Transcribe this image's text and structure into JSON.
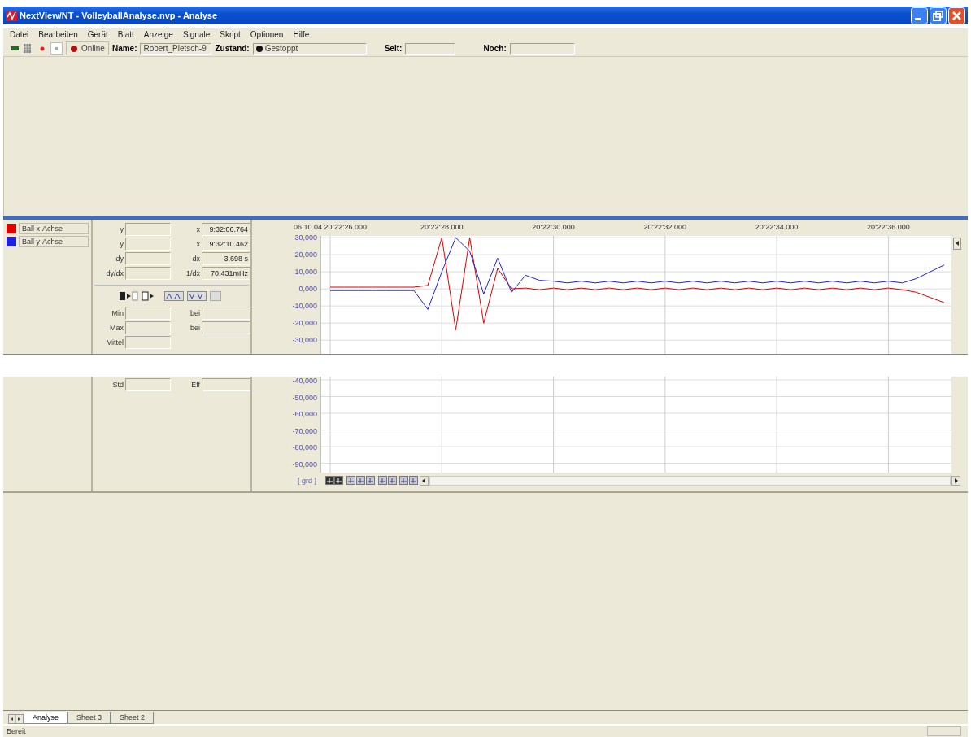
{
  "window": {
    "title": "NextView/NT - VolleyballAnalyse.nvp - Analyse"
  },
  "menu": [
    "Datei",
    "Bearbeiten",
    "Gerät",
    "Blatt",
    "Anzeige",
    "Signale",
    "Skript",
    "Optionen",
    "Hilfe"
  ],
  "toolbar": {
    "mode": "Online",
    "name_label": "Name:",
    "name_value": "Robert_Pietsch-9",
    "state_label": "Zustand:",
    "state_value": "Gestoppt",
    "since_label": "Seit:",
    "remaining_label": "Noch:"
  },
  "cursor": [
    {
      "label": "y",
      "label2": "x",
      "value2": "9:32:06.764"
    },
    {
      "label": "y",
      "label2": "x",
      "value2": "9:32:10.462"
    },
    {
      "label": "dy",
      "label2": "dx",
      "value2": "3,698 s"
    },
    {
      "label": "dy/dx",
      "label2": "1/dx",
      "value2": "70,431mHz"
    }
  ],
  "stats": [
    {
      "label": "Min",
      "label2": "bei"
    },
    {
      "label": "Max",
      "label2": "bei"
    },
    {
      "label": "Mittel"
    }
  ],
  "stats_lower": [
    {
      "label": "Std",
      "label2": "Eff"
    }
  ],
  "chart": {
    "chart_data": {
      "type": "line",
      "categories": [
        "06.10.04 20:22:26.000",
        null,
        null,
        null,
        null,
        null,
        null,
        null,
        "20:22:28.000",
        null,
        null,
        null,
        null,
        null,
        null,
        null,
        "20:22:30.000",
        null,
        null,
        null,
        null,
        null,
        null,
        null,
        "20:22:32.000",
        null,
        null,
        null,
        null,
        null,
        null,
        null,
        "20:22:34.000",
        null,
        null,
        null,
        null,
        null,
        null,
        null,
        "20:22:36.000",
        null,
        null,
        null,
        null
      ],
      "series": [
        {
          "name": "Ball x-Achse",
          "color": "#e00000",
          "values": [
            1000,
            1000,
            1000,
            1000,
            1000,
            1000,
            1000,
            2000,
            30000,
            -24000,
            30000,
            -20000,
            12000,
            0,
            500,
            -500,
            500,
            -500,
            500,
            -500,
            500,
            -500,
            500,
            -500,
            500,
            -500,
            500,
            -500,
            500,
            -500,
            500,
            -500,
            500,
            -500,
            500,
            -500,
            500,
            -500,
            500,
            -500,
            500,
            -500,
            -2000,
            -5000,
            -8000
          ]
        },
        {
          "name": "Ball y-Achse",
          "color": "#2020e0",
          "values": [
            -1000,
            -1000,
            -1000,
            -1000,
            -1000,
            -1000,
            -1000,
            -12000,
            10000,
            30000,
            22000,
            -3000,
            18000,
            -2000,
            8000,
            5000,
            4500,
            3500,
            4500,
            3500,
            4500,
            3500,
            4500,
            3500,
            4500,
            3500,
            4500,
            3500,
            4500,
            3500,
            4500,
            3500,
            4500,
            3500,
            4500,
            3500,
            4500,
            3500,
            4500,
            3500,
            4500,
            3500,
            6000,
            10000,
            14000
          ]
        }
      ],
      "ylim": [
        -38000,
        31000
      ],
      "grid": true,
      "yticks": [
        {
          "value": 30000,
          "label": "30,000"
        },
        {
          "value": 20000,
          "label": "20,000"
        },
        {
          "value": 10000,
          "label": "10,000"
        },
        {
          "value": 0,
          "label": "0,000"
        },
        {
          "value": -10000,
          "label": "-10,000"
        },
        {
          "value": -20000,
          "label": "-20,000"
        },
        {
          "value": -30000,
          "label": "-30,000"
        }
      ]
    },
    "y_labels_lower": [
      "-40,000",
      "-50,000",
      "-60,000",
      "-70,000",
      "-80,000",
      "-90,000"
    ],
    "grid_button": "[ grd ]"
  },
  "sheet_tabs": [
    {
      "label": "Analyse",
      "selected": true
    },
    {
      "label": "Sheet 3",
      "selected": false
    },
    {
      "label": "Sheet 2",
      "selected": false
    }
  ],
  "status_bar": "Bereit"
}
